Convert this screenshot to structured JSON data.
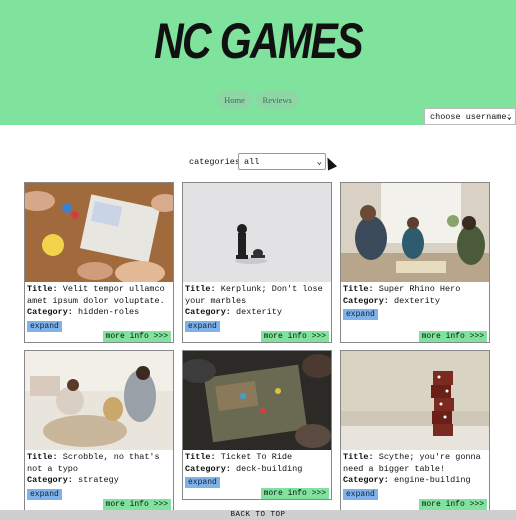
{
  "header": {
    "logo": "NC GAMES",
    "nav": [
      "Home",
      "Reviews"
    ],
    "user_select": "choose username:"
  },
  "filter": {
    "label": "categories:",
    "value": "all"
  },
  "labels": {
    "title": "Title:",
    "category": "Category:",
    "expand": "expand",
    "more": "more info >>>"
  },
  "reviews": [
    {
      "title": "Velit tempor ullamco amet ipsum dolor voluptate.",
      "category": "hidden-roles",
      "image": "people-board-game-photo"
    },
    {
      "title": "Kerplunk; Don't lose your marbles",
      "category": "dexterity",
      "image": "chess-pieces-photo"
    },
    {
      "title": "Super Rhino Hero",
      "category": "dexterity",
      "image": "family-playing-photo"
    },
    {
      "title": "Scrobble, no that's not a typo",
      "category": "strategy",
      "image": "family-floor-game-photo"
    },
    {
      "title": "Ticket To Ride",
      "category": "deck-building",
      "image": "board-game-table-photo"
    },
    {
      "title": "Scythe; you're gonna need a bigger table!",
      "category": "engine-building",
      "image": "dice-tower-photo"
    }
  ],
  "footer": {
    "back_to_top": "BACK TO TOP"
  },
  "colors": {
    "header_bg": "#7fe29d",
    "nav_btn": "#8fd6a6",
    "expand_btn": "#7fb2e8",
    "more_btn": "#7fe29d"
  }
}
